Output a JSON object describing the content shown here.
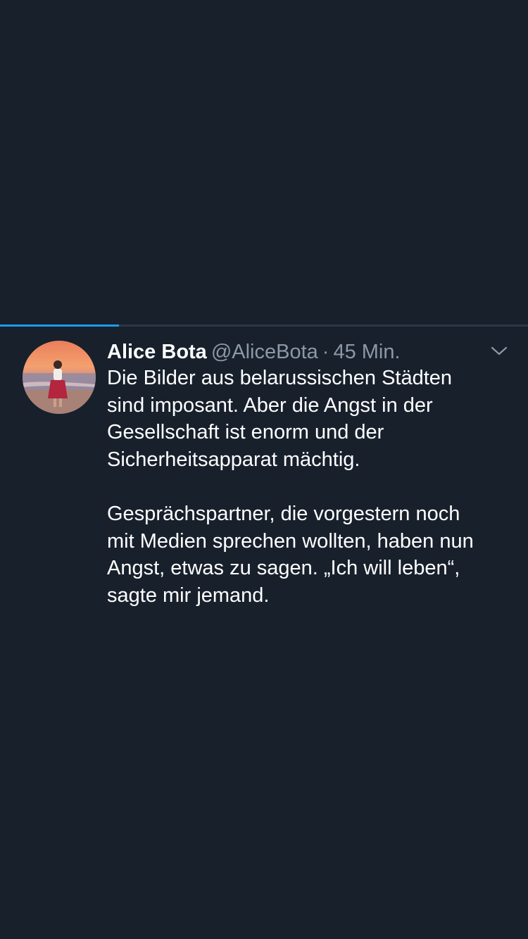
{
  "video_progress": {
    "fraction": 0.225,
    "colors": {
      "track": "#2c3744",
      "fill": "#1d9bf0"
    }
  },
  "tweet": {
    "display_name": "Alice Bota",
    "handle": "@AliceBota",
    "separator": "·",
    "timestamp": "45 Min.",
    "paragraphs": [
      "Die Bilder aus belarussischen Städten\nsind imposant. Aber die Angst in der\nGesellschaft ist enorm und der\nSicherheitsapparat mächtig.",
      "Gesprächspartner, die vorgestern noch\nmit Medien sprechen wollten, haben nun\nAngst, etwas zu sagen. „Ich will leben“,\nsagte mir jemand."
    ],
    "menu_icon": "chevron-down-icon",
    "avatar_icon": "profile-photo"
  },
  "colors": {
    "background": "#18202c",
    "primary_text": "#ffffff",
    "secondary_text": "#8b98a5",
    "accent": "#1d9bf0"
  }
}
